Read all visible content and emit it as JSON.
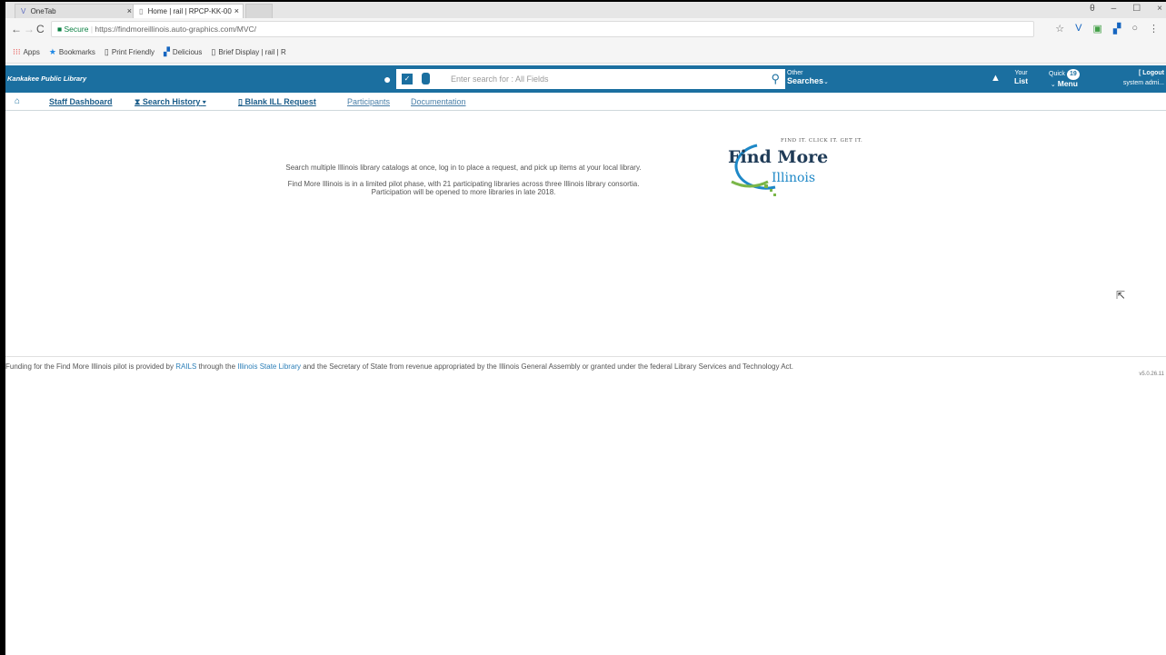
{
  "browser": {
    "tabs": [
      {
        "label": "OneTab",
        "close": "×"
      },
      {
        "label": "Home | rail | RPCP-KK-00",
        "close": "×"
      }
    ],
    "window_controls": [
      "θ",
      "–",
      "☐",
      "×"
    ],
    "address": {
      "secure_label": "Secure",
      "url": "https://findmoreillinois.auto-graphics.com/MVC/"
    },
    "bookmarks": [
      "Apps",
      "Bookmarks",
      "Print Friendly",
      "Delicious",
      "Brief Display | rail | R"
    ]
  },
  "appbar": {
    "library_name": "Kankakee Public Library",
    "search_placeholder": "Enter search for : All Fields",
    "other_top": "Other",
    "other_bottom": "Searches",
    "your_top": "Your",
    "your_bottom": "List",
    "quick_top": "Quick",
    "quick_bottom": "Menu",
    "quick_badge": "19",
    "logout": "[ Logout",
    "user": "system admi..."
  },
  "nav": {
    "items": [
      "Staff Dashboard",
      "Search History",
      "Blank ILL Request",
      "Participants",
      "Documentation"
    ]
  },
  "main": {
    "intro_line1": "Search multiple Illinois library catalogs at once, log in to place a request, and pick up items at your local library.",
    "intro_line2": "Find More Illinois is in a limited pilot phase, with 21 participating libraries across three Illinois library consortia.",
    "intro_line3": "Participation will be opened to more libraries in late 2018.",
    "logo_tagline": "FIND IT. CLICK IT. GET IT.",
    "logo_find": "Find More",
    "logo_illinois": "Illinois"
  },
  "footer": {
    "part1": "Funding for the Find More Illinois pilot is provided by ",
    "rails": "RAILS",
    "part2": " through the ",
    "isl": "Illinois State Library",
    "part3": " and the Secretary of State from revenue appropriated by the Illinois General Assembly or granted under the federal Library Services and Technology Act.",
    "version": "v5.0.26.11"
  },
  "colors": {
    "brand_blue": "#1b6fa0",
    "logo_green": "#7ab648",
    "link_blue": "#2c7fb8"
  }
}
